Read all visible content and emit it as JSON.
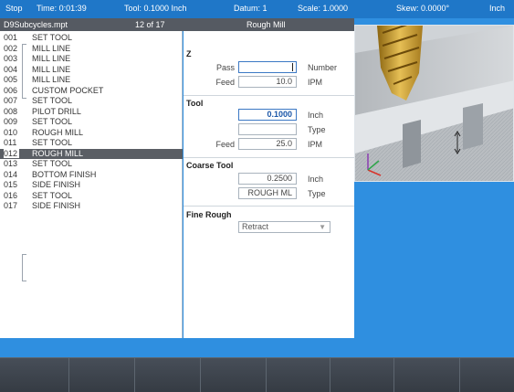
{
  "status": {
    "mode": "Stop",
    "time": "Time: 0:01:39",
    "tool": "Tool: 0.1000 Inch",
    "datum": "Datum: 1",
    "scale": "Scale: 1.0000",
    "skew": "Skew: 0.0000°",
    "units": "Inch"
  },
  "program": {
    "filename": "D9Subcycles.mpt",
    "position": "12 of 17",
    "step_title": "Rough Mill"
  },
  "blocks": [
    {
      "num": "001",
      "label": "SET TOOL"
    },
    {
      "num": "002",
      "label": "MILL LINE"
    },
    {
      "num": "003",
      "label": "MILL LINE"
    },
    {
      "num": "004",
      "label": "MILL LINE"
    },
    {
      "num": "005",
      "label": "MILL LINE"
    },
    {
      "num": "006",
      "label": "CUSTOM POCKET"
    },
    {
      "num": "007",
      "label": "SET TOOL"
    },
    {
      "num": "008",
      "label": "PILOT DRILL"
    },
    {
      "num": "009",
      "label": "SET TOOL"
    },
    {
      "num": "010",
      "label": "ROUGH MILL"
    },
    {
      "num": "011",
      "label": "SET TOOL"
    },
    {
      "num": "012",
      "label": "ROUGH MILL"
    },
    {
      "num": "013",
      "label": "SET TOOL"
    },
    {
      "num": "014",
      "label": "BOTTOM FINISH"
    },
    {
      "num": "015",
      "label": "SIDE FINISH"
    },
    {
      "num": "016",
      "label": "SET TOOL"
    },
    {
      "num": "017",
      "label": "SIDE FINISH"
    }
  ],
  "params": {
    "z": {
      "title": "Z",
      "pass_label": "Pass",
      "pass_value": "",
      "pass_unit": "Number",
      "feed_label": "Feed",
      "feed_value": "10.0",
      "feed_unit": "IPM"
    },
    "tool": {
      "title": "Tool",
      "diameter_value": "0.1000",
      "diameter_unit": "Inch",
      "type_value": "",
      "type_unit": "Type",
      "feed_label": "Feed",
      "feed_value": "25.0",
      "feed_unit": "IPM"
    },
    "coarse_tool": {
      "title": "Coarse Tool",
      "diameter_value": "0.2500",
      "diameter_unit": "Inch",
      "type_value": "ROUGH ML",
      "type_unit": "Type"
    },
    "fine_rough": {
      "title": "Fine Rough",
      "selected": "Retract"
    }
  },
  "softkeys": [
    "",
    "",
    "",
    "",
    "",
    "",
    "",
    ""
  ],
  "colors": {
    "background": "#2f8fe0",
    "status_bar": "#1f77c8",
    "header": "#555a62",
    "selected_row": "#5a5e64",
    "tool_gold": "#d4a537"
  }
}
